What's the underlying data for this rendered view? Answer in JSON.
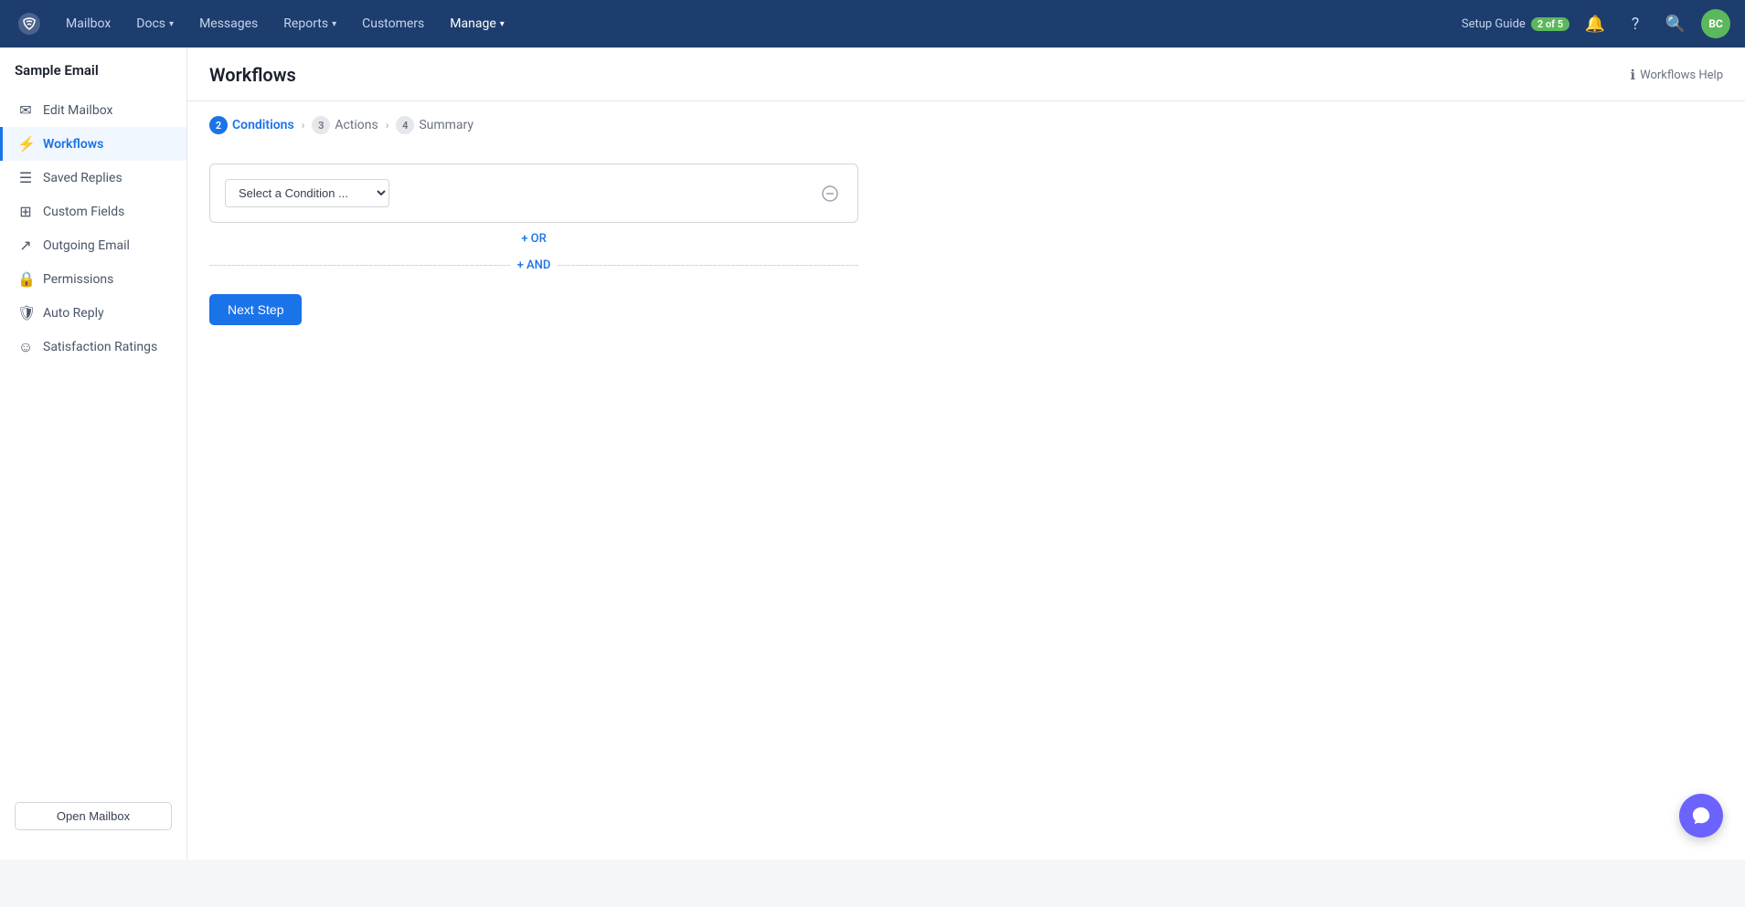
{
  "topnav": {
    "logo_alt": "HelpScout Logo",
    "items": [
      {
        "label": "Mailbox",
        "has_dropdown": false,
        "active": false
      },
      {
        "label": "Docs",
        "has_dropdown": true,
        "active": false
      },
      {
        "label": "Messages",
        "has_dropdown": false,
        "active": false
      },
      {
        "label": "Reports",
        "has_dropdown": true,
        "active": false
      },
      {
        "label": "Customers",
        "has_dropdown": false,
        "active": false
      },
      {
        "label": "Manage",
        "has_dropdown": true,
        "active": true
      }
    ],
    "setup_guide_label": "Setup Guide",
    "setup_badge": "2 of 5",
    "avatar_initials": "BC"
  },
  "sidebar": {
    "title": "Sample Email",
    "items": [
      {
        "label": "Edit Mailbox",
        "icon": "✉",
        "active": false
      },
      {
        "label": "Workflows",
        "icon": "⚡",
        "active": true
      },
      {
        "label": "Saved Replies",
        "icon": "☰",
        "active": false
      },
      {
        "label": "Custom Fields",
        "icon": "⊞",
        "active": false
      },
      {
        "label": "Outgoing Email",
        "icon": "↗",
        "active": false
      },
      {
        "label": "Permissions",
        "icon": "🔒",
        "active": false
      },
      {
        "label": "Auto Reply",
        "icon": "🛡",
        "active": false
      },
      {
        "label": "Satisfaction Ratings",
        "icon": "☺",
        "active": false
      }
    ],
    "open_mailbox_label": "Open Mailbox"
  },
  "page": {
    "title": "Workflows",
    "help_label": "Workflows Help",
    "breadcrumb": [
      {
        "num": "2",
        "label": "Conditions",
        "active": true
      },
      {
        "num": "3",
        "label": "Actions",
        "active": false
      },
      {
        "num": "4",
        "label": "Summary",
        "active": false
      }
    ],
    "condition": {
      "select_placeholder": "Select a Condition ...",
      "or_label": "+ OR",
      "and_label": "+ AND",
      "remove_icon": "⊖"
    },
    "next_step_label": "Next Step"
  }
}
